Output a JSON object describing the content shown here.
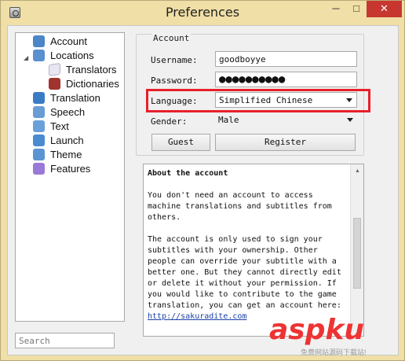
{
  "window": {
    "title": "Preferences",
    "min_label": "─",
    "max_label": "□",
    "close_label": "✕"
  },
  "sidebar": {
    "items": [
      {
        "label": "Account",
        "icon": "account-icon"
      },
      {
        "label": "Locations",
        "icon": "locations-icon"
      },
      {
        "label": "Translators",
        "icon": "translators-icon"
      },
      {
        "label": "Dictionaries",
        "icon": "dictionaries-icon"
      },
      {
        "label": "Translation",
        "icon": "translation-icon"
      },
      {
        "label": "Speech",
        "icon": "speech-icon"
      },
      {
        "label": "Text",
        "icon": "text-icon"
      },
      {
        "label": "Launch",
        "icon": "launch-icon"
      },
      {
        "label": "Theme",
        "icon": "theme-icon"
      },
      {
        "label": "Features",
        "icon": "features-icon"
      }
    ],
    "search_placeholder": "Search"
  },
  "account": {
    "legend": "Account",
    "username_label": "Username:",
    "username_value": "goodboyye",
    "password_label": "Password:",
    "password_value": "●●●●●●●●●●",
    "language_label": "Language:",
    "language_value": "Simplified Chinese",
    "gender_label": "Gender:",
    "gender_value": "Male",
    "guest_button": "Guest",
    "register_button": "Register"
  },
  "info": {
    "heading": "About the account",
    "p1": "You don't need an account to access machine translations and subtitles from others.",
    "p2": "The account is only used to sign your subtitles with your ownership. Other people can override your subtitle with a better one. But they cannot directly edit or delete it without your permission. If you would like to contribute to the game translation, you can get an account here:",
    "link": "http://sakuradite.com"
  },
  "watermark": {
    "text": "aspku",
    "sub": "免费网站源码下载站!"
  },
  "colors": {
    "highlight": "#e8202b",
    "window_bg": "#f0dfa6",
    "link": "#1a3fa8"
  }
}
